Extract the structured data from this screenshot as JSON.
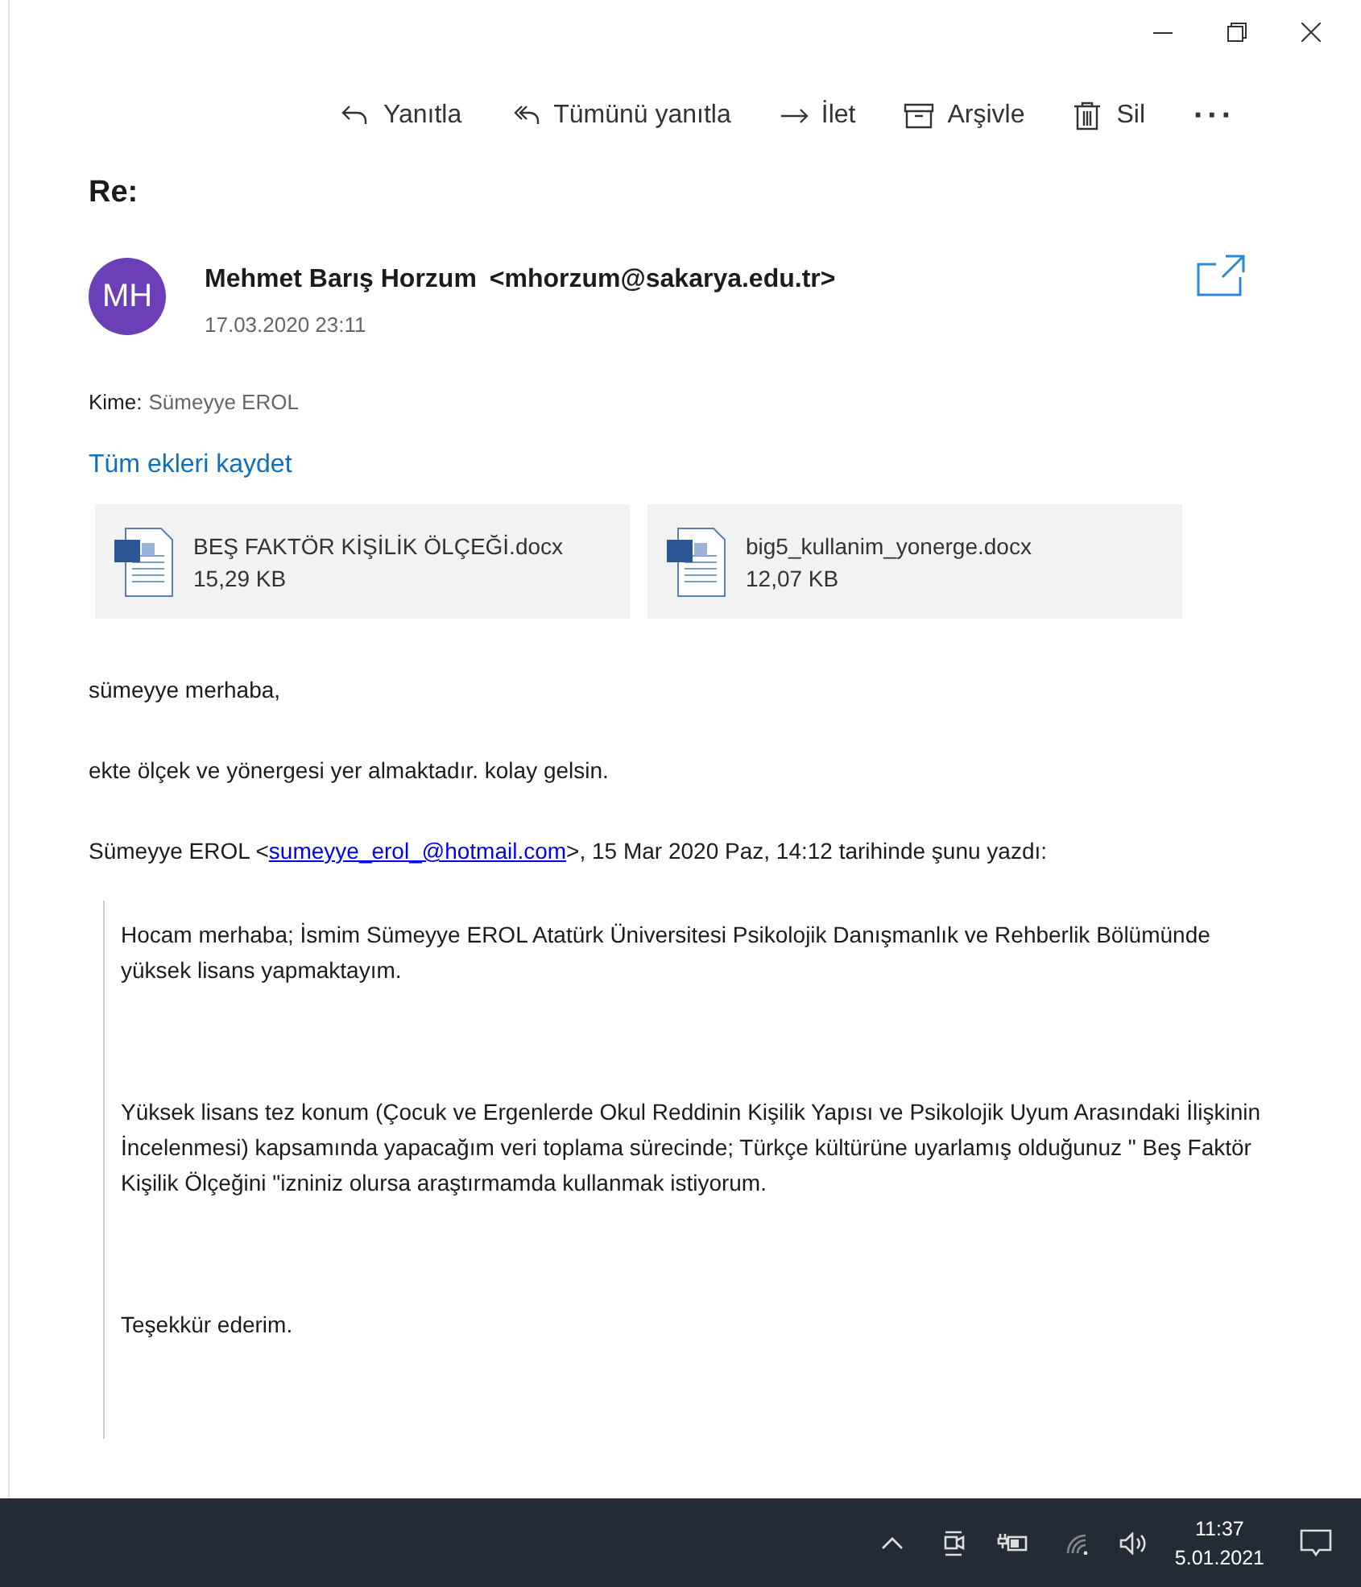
{
  "toolbar": [
    {
      "kind": "reply",
      "label": "Yanıtla"
    },
    {
      "kind": "reply_all",
      "label": "Tümünü yanıtla"
    },
    {
      "kind": "forward",
      "label": "İlet"
    },
    {
      "kind": "archive",
      "label": "Arşivle"
    },
    {
      "kind": "delete",
      "label": "Sil"
    },
    {
      "kind": "more",
      "label": "···"
    }
  ],
  "message": {
    "subject": "Re:",
    "avatar_initials": "MH",
    "sender": "Mehmet Barış Horzum",
    "sender_email": "<mhorzum@sakarya.edu.tr>",
    "date": "17.03.2020 23:11",
    "to_label": "Kime:",
    "to": "Sümeyye EROL",
    "save_all": "Tüm ekleri kaydet",
    "attachments": [
      {
        "name": "BEŞ FAKTÖR KİŞİLİK ÖLÇEĞİ.docx",
        "size": "15,29 KB"
      },
      {
        "name": "big5_kullanim_yonerge.docx",
        "size": "12,07 KB"
      }
    ],
    "body": [
      "sümeyye merhaba,",
      "ekte ölçek ve yönergesi yer almaktadır. kolay gelsin."
    ],
    "quote_header": {
      "before": "Sümeyye EROL <",
      "link": "sumeyye_erol_@hotmail.com",
      "after": ">, 15 Mar 2020 Paz, 14:12 tarihinde şunu yazdı:"
    },
    "quote": [
      "Hocam merhaba; İsmim Sümeyye EROL Atatürk Üniversitesi Psikolojik Danışmanlık ve Rehberlik Bölümünde yüksek lisans yapmaktayım.",
      "Yüksek lisans tez konum (Çocuk ve Ergenlerde Okul Reddinin Kişilik Yapısı ve Psikolojik Uyum Arasındaki İlişkinin İncelenmesi) kapsamında yapacağım veri toplama sürecinde; Türkçe kültürüne uyarlamış olduğunuz \" Beş Faktör Kişilik Ölçeğini \"izniniz olursa araştırmamda kullanmak istiyorum.",
      "Teşekkür ederim."
    ]
  },
  "taskbar": {
    "time": "11:37",
    "date": "5.01.2021"
  }
}
